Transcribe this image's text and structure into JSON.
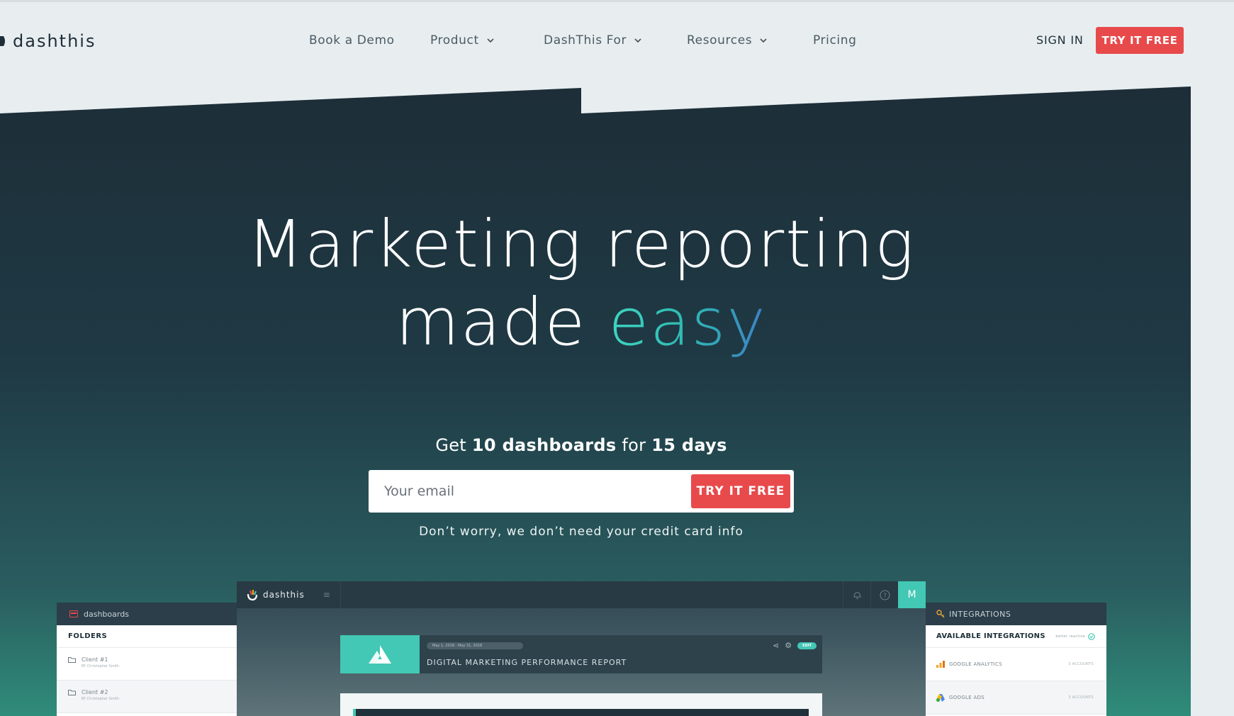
{
  "brand": {
    "name": "dashthis"
  },
  "nav": {
    "items": [
      {
        "label": "Book a Demo",
        "dropdown": false
      },
      {
        "label": "Product",
        "dropdown": true
      },
      {
        "label": "DashThis For",
        "dropdown": true
      },
      {
        "label": "Resources",
        "dropdown": true
      },
      {
        "label": "Pricing",
        "dropdown": false
      }
    ],
    "sign_in": "SIGN IN",
    "cta": "TRY IT FREE"
  },
  "hero": {
    "headline_line1": "Marketing reporting",
    "headline_line2_prefix": "made ",
    "headline_line2_highlight": "easy",
    "offer_get": "Get ",
    "offer_dashboards": "10 dashboards",
    "offer_for": " for ",
    "offer_days": "15 days",
    "email_placeholder": "Your email",
    "cta": "TRY IT FREE",
    "disclaimer": "Don’t worry, we don’t need your credit card info"
  },
  "preview": {
    "left_panel": {
      "title": "dashboards",
      "folders_label": "FOLDERS",
      "folders": [
        {
          "name": "Client #1",
          "owner": "BY Christopher Smith"
        },
        {
          "name": "Client #2",
          "owner": "BY Christopher Smith"
        }
      ]
    },
    "main_panel": {
      "app_name": "dashthis",
      "user_initial": "M",
      "date_range": "May 1, 2018 - May 31, 2018",
      "report_title": "DIGITAL MARKETING PERFORMANCE REPORT",
      "edit_label": "EDIT"
    },
    "right_panel": {
      "title": "INTEGRATIONS",
      "available_label": "AVAILABLE INTEGRATIONS",
      "select_label": "better reactive",
      "integrations": [
        {
          "name": "GOOGLE ANALYTICS",
          "accounts": "3 ACCOUNTS"
        },
        {
          "name": "GOOGLE ADS",
          "accounts": "3 ACCOUNTS"
        }
      ]
    }
  },
  "colors": {
    "hero_top": "#1d2e38",
    "hero_bottom": "#2a7f73",
    "cta_red": "#e84a4c",
    "accent_teal": "#42c8b4",
    "header_bg": "#e8eef0"
  }
}
